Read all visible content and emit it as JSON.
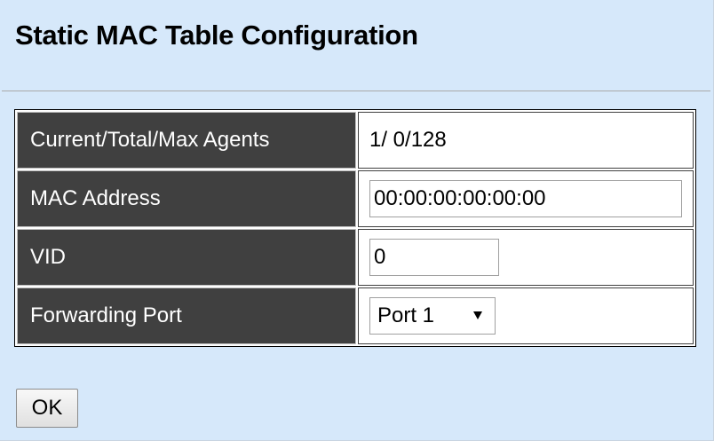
{
  "page": {
    "title": "Static MAC Table Configuration"
  },
  "form": {
    "rows": [
      {
        "label": "Current/Total/Max Agents",
        "value": "1/ 0/128"
      },
      {
        "label": "MAC Address",
        "value": "00:00:00:00:00:00"
      },
      {
        "label": "VID",
        "value": "0"
      },
      {
        "label": "Forwarding Port",
        "value": "Port 1"
      }
    ]
  },
  "actions": {
    "ok_label": "OK"
  },
  "colors": {
    "page_background": "#d6e8fa",
    "label_cell_background": "#404040",
    "label_text": "#ffffff"
  }
}
